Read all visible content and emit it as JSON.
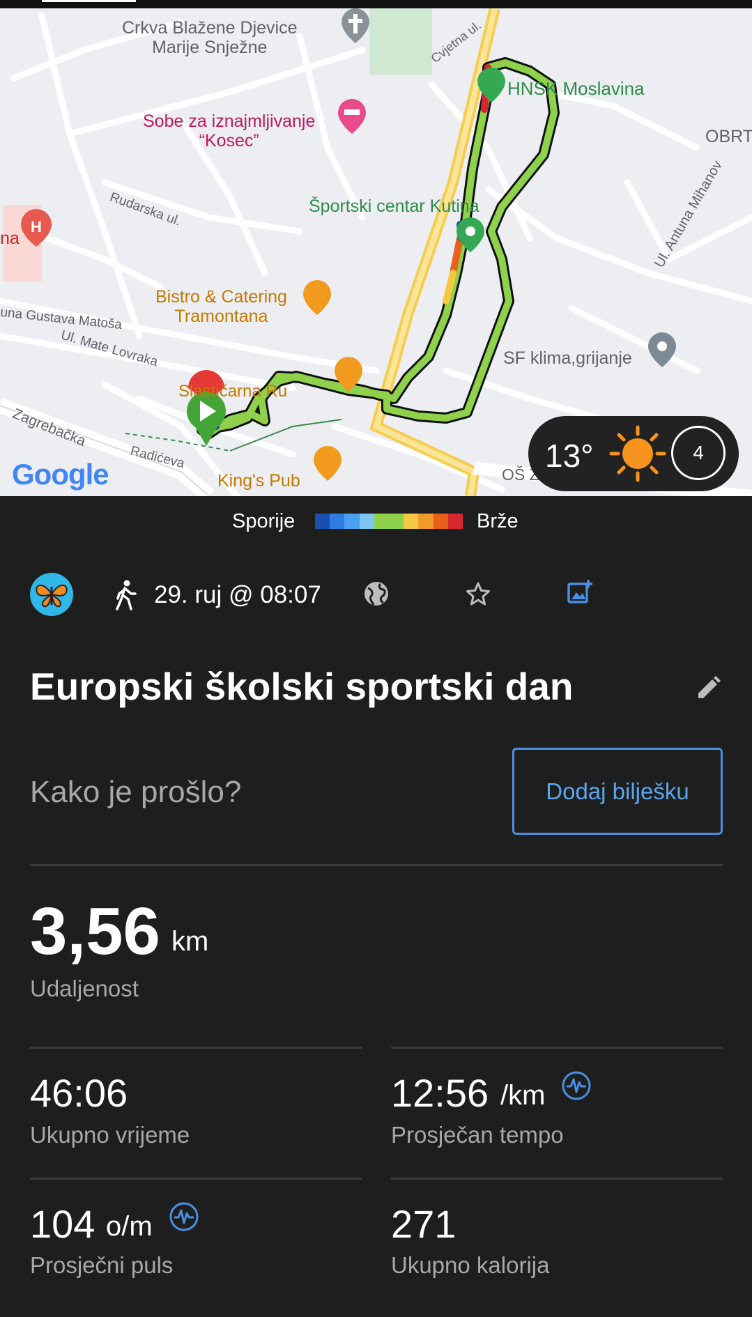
{
  "map": {
    "labels": {
      "church": "Crkva Blažene Djevice\nMarije Snježne",
      "cvjetna": "Cvjetna ul.",
      "hnsk": "HNSK Moslavina",
      "obrt": "OBRT",
      "sobe": "Sobe za iznajmljivanje\n“Kosec”",
      "rudarska": "Rudarska ul.",
      "sportski": "Športski centar Kutina",
      "hosp": "na",
      "mihanov": "Ul. Antuna Mihanov",
      "bistro": "Bistro & Catering\nTramontana",
      "matosa": "una Gustava Matoša",
      "lovraka": "Ul. Mate Lovraka",
      "sfklima": "SF klima,grijanje",
      "slasticarna": "Slastičarna Ru",
      "zagrebacka": "Zagrebačka",
      "radiceva": "Radićeva",
      "kingspub": "King's Pub",
      "os": "OŠ Z",
      "google": "Google"
    },
    "weather": {
      "temp": "13°",
      "wind": "4"
    }
  },
  "legend": {
    "slow": "Sporije",
    "fast": "Brže",
    "colors": [
      "#1a4fb0",
      "#2f7be0",
      "#4aa0f0",
      "#7cc7f2",
      "#8fd14a",
      "#8fd14a",
      "#f5c842",
      "#f09a2a",
      "#e8601c",
      "#d8262e"
    ]
  },
  "activity": {
    "date": "29. ruj @ 08:07",
    "title": "Europski školski sportski dan",
    "prompt": "Kako je prošlo?",
    "add_note": "Dodaj bilješku"
  },
  "stats": {
    "distance": {
      "value": "3,56",
      "unit": "km",
      "label": "Udaljenost"
    },
    "time": {
      "value": "46:06",
      "label": "Ukupno vrijeme"
    },
    "pace": {
      "value": "12:56",
      "unit": "/km",
      "label": "Prosječan tempo"
    },
    "hr": {
      "value": "104",
      "unit": "o/m",
      "label": "Prosječni puls"
    },
    "calories": {
      "value": "271",
      "label": "Ukupno kalorija"
    }
  },
  "colors": {
    "accent": "#4a90e2",
    "background": "#1e1e1e",
    "route": "#8fd14a"
  }
}
